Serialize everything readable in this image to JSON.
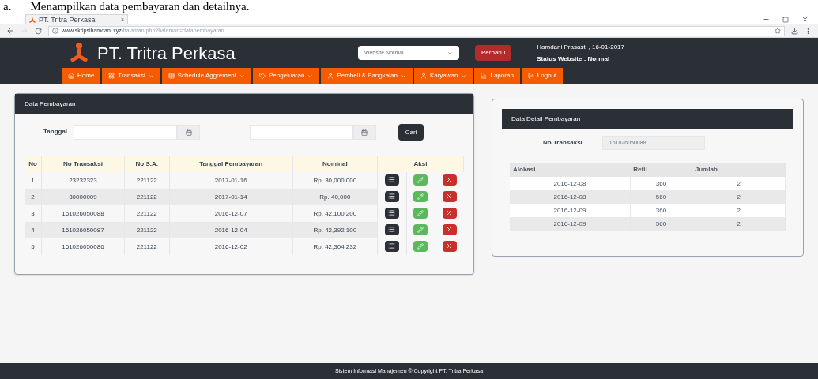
{
  "caption": {
    "label": "a.",
    "text": "Menampilkan data pembayaran dan detailnya."
  },
  "browser": {
    "tab_title": "PT. Tritra Perkasa",
    "tab_close": "×",
    "url_host": "www.skripsihamdani.xyz",
    "url_path": "/halaman.php?halaman=datapembayaran"
  },
  "header": {
    "brand": "PT. Tritra Perkasa",
    "mode_select": "Website Normal",
    "update_button": "Perbarui",
    "user_line": "Hamdani Prasasti , 16-01-2017",
    "status_line": "Status Website : Normal"
  },
  "nav": [
    {
      "label": "Home",
      "kind": "home",
      "dropdown": false
    },
    {
      "label": "Transaksi",
      "kind": "grid",
      "dropdown": true
    },
    {
      "label": "Schedule Aggrement",
      "kind": "table",
      "dropdown": true
    },
    {
      "label": "Pengeluaran",
      "kind": "tag",
      "dropdown": true
    },
    {
      "label": "Pembeli & Pangkalan",
      "kind": "user",
      "dropdown": true
    },
    {
      "label": "Karyawan",
      "kind": "user",
      "dropdown": true
    },
    {
      "label": "Laporan",
      "kind": "chart",
      "dropdown": false
    },
    {
      "label": "Logout",
      "kind": "logout",
      "dropdown": false
    }
  ],
  "payments": {
    "title": "Data Pembayaran",
    "filter_label": "Tanggal",
    "range_separator": "-",
    "search_button": "Cari",
    "columns": [
      "No",
      "No Transaksi",
      "No S.A.",
      "Tanggal Pembayaran",
      "Nominal",
      "Aksi"
    ],
    "rows": [
      [
        "1",
        "23232323",
        "221122",
        "2017-01-16",
        "Rp. 30,000,000"
      ],
      [
        "2",
        "30000009",
        "221122",
        "2017-01-14",
        "Rp. 40,000"
      ],
      [
        "3",
        "161026050088",
        "221122",
        "2016-12-07",
        "Rp. 42,100,200"
      ],
      [
        "4",
        "161026050087",
        "221122",
        "2016-12-04",
        "Rp. 42,392,100"
      ],
      [
        "5",
        "161026050086",
        "221122",
        "2016-12-02",
        "Rp. 42,304,232"
      ]
    ]
  },
  "detail": {
    "title": "Data Detail Pembayaran",
    "field_label": "No Transaksi",
    "field_value": "161026050088",
    "columns": [
      "Alokasi",
      "Refil",
      "Jumlah"
    ],
    "rows": [
      [
        "2016-12-08",
        "360",
        "2"
      ],
      [
        "2016-12-08",
        "560",
        "2"
      ],
      [
        "2016-12-09",
        "360",
        "2"
      ],
      [
        "2016-12-09",
        "560",
        "2"
      ]
    ]
  },
  "footer": "Sistem Informasi Manajemen © Copyright PT. Tritra Perkasa"
}
